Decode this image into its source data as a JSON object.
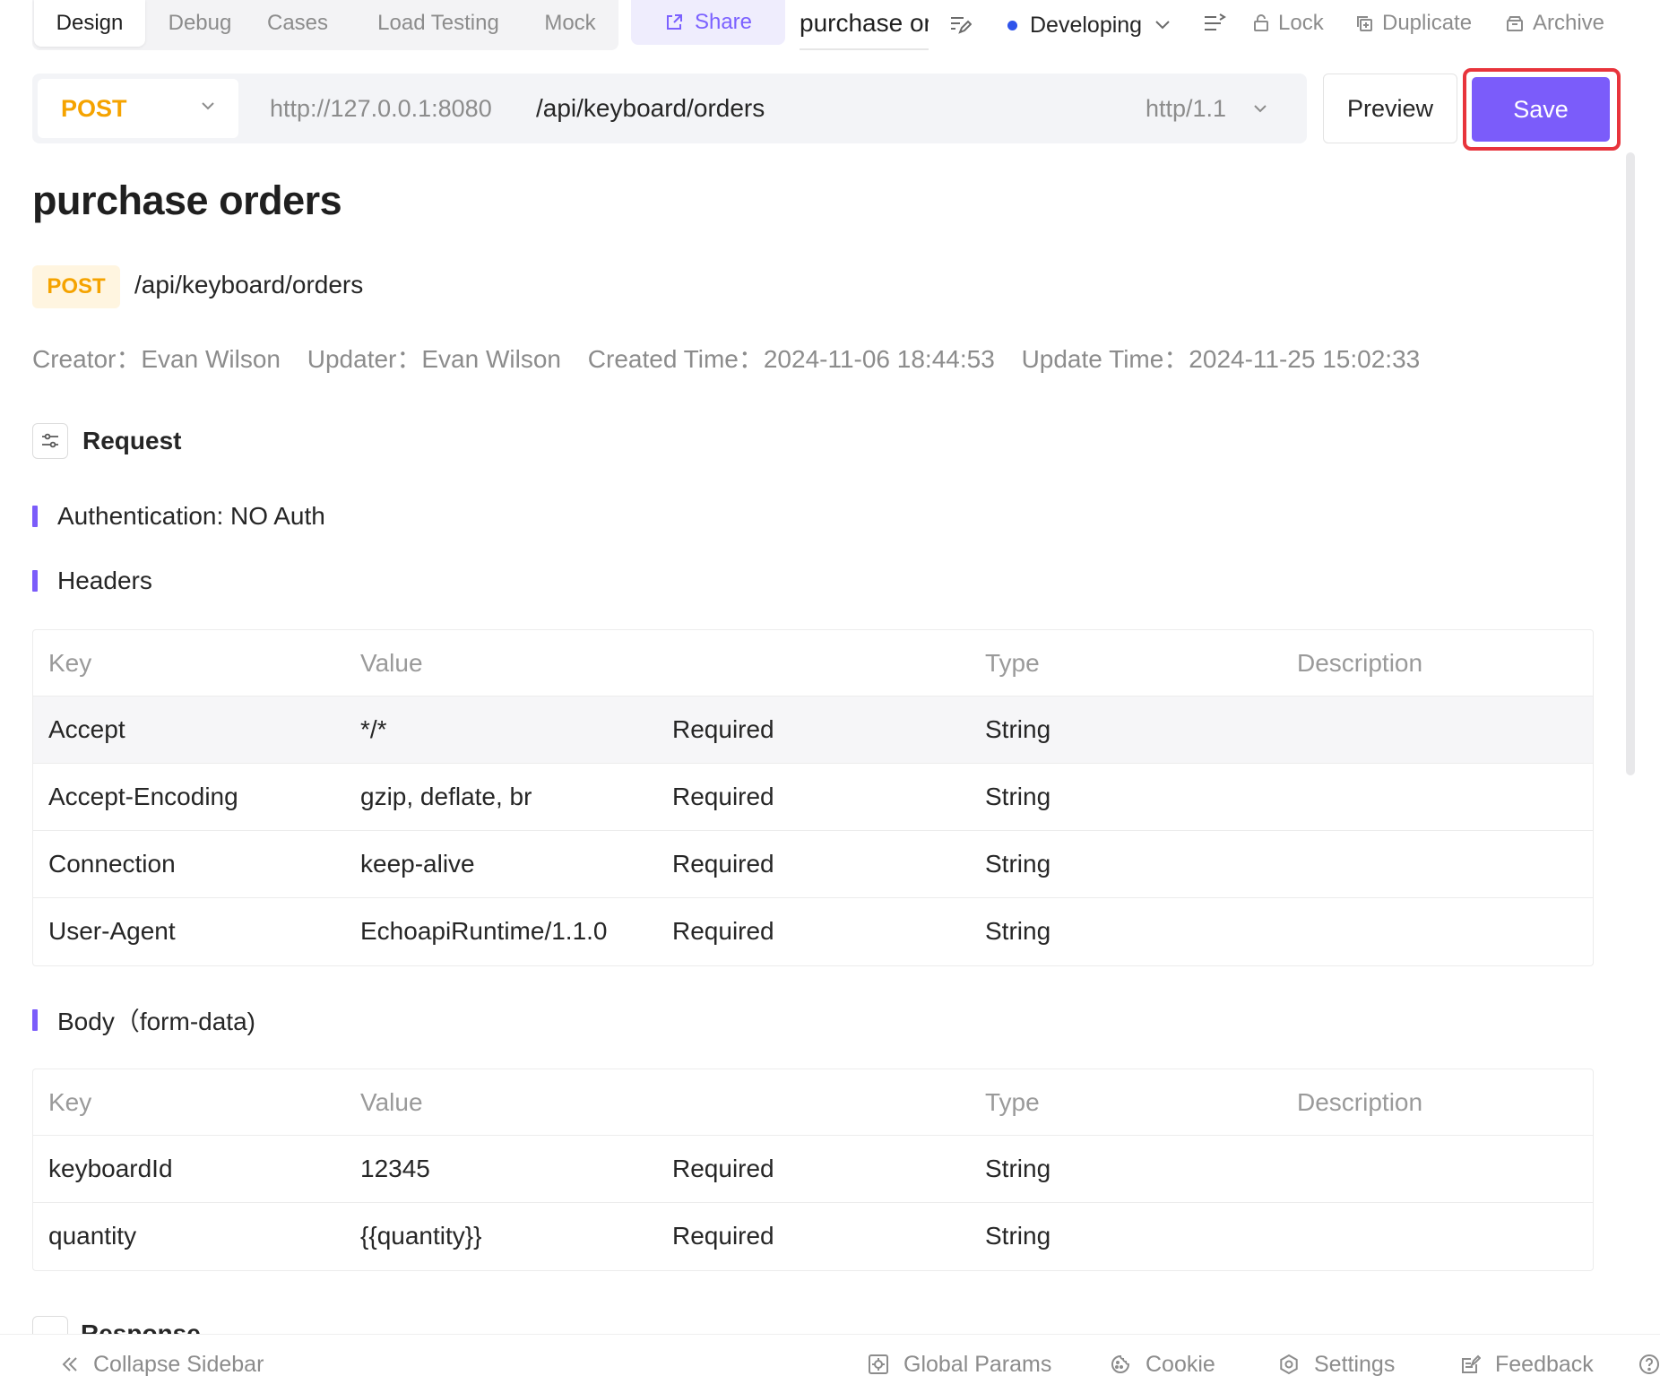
{
  "tabs": [
    {
      "label": "Design",
      "active": true
    },
    {
      "label": "Debug",
      "active": false
    },
    {
      "label": "Cases",
      "active": false
    },
    {
      "label": "Load Testing",
      "active": false
    },
    {
      "label": "Mock",
      "active": false
    }
  ],
  "toolbar": {
    "share_label": "Share",
    "api_name": "purchase orders",
    "status_label": "Developing",
    "lock_label": "Lock",
    "duplicate_label": "Duplicate",
    "archive_label": "Archive"
  },
  "request_bar": {
    "method": "POST",
    "base_url": "http://127.0.0.1:8080",
    "path": "/api/keyboard/orders",
    "protocol": "http/1.1",
    "preview_label": "Preview",
    "save_label": "Save"
  },
  "doc": {
    "title": "purchase orders",
    "method": "POST",
    "path": "/api/keyboard/orders",
    "meta": {
      "creator": "Creator：Evan Wilson",
      "updater": "Updater：Evan Wilson",
      "created": "Created Time：2024-11-06 18:44:53",
      "updated": "Update Time：2024-11-25 15:02:33"
    },
    "request_label": "Request",
    "auth_label": "Authentication: NO Auth",
    "headers_label": "Headers",
    "body_label": "Body（form-data)",
    "response_label": "Response"
  },
  "table_columns": [
    "Key",
    "Value",
    "Type",
    "Description"
  ],
  "headers": [
    {
      "key": "Accept",
      "value": "*/*",
      "required": "Required",
      "type": "String",
      "description": ""
    },
    {
      "key": "Accept-Encoding",
      "value": "gzip, deflate, br",
      "required": "Required",
      "type": "String",
      "description": ""
    },
    {
      "key": "Connection",
      "value": "keep-alive",
      "required": "Required",
      "type": "String",
      "description": ""
    },
    {
      "key": "User-Agent",
      "value": "EchoapiRuntime/1.1.0",
      "required": "Required",
      "type": "String",
      "description": ""
    }
  ],
  "body": [
    {
      "key": "keyboardId",
      "value": "12345",
      "required": "Required",
      "type": "String",
      "description": ""
    },
    {
      "key": "quantity",
      "value": "{{quantity}}",
      "required": "Required",
      "type": "String",
      "description": ""
    }
  ],
  "footer": {
    "collapse_label": "Collapse Sidebar",
    "global_params_label": "Global Params",
    "cookie_label": "Cookie",
    "settings_label": "Settings",
    "feedback_label": "Feedback"
  },
  "colors": {
    "accent": "#7b5cfa",
    "method_post": "#f5a300",
    "status_dot": "#2f54eb",
    "highlight_border": "#e8343c"
  },
  "icons": [
    "share-icon",
    "edit-icon",
    "chevron-down-icon",
    "align-icon",
    "lock-icon",
    "duplicate-icon",
    "archive-icon",
    "sliders-icon",
    "double-chevron-left-icon",
    "global-params-icon",
    "cookie-icon",
    "settings-icon",
    "feedback-icon",
    "help-icon"
  ]
}
